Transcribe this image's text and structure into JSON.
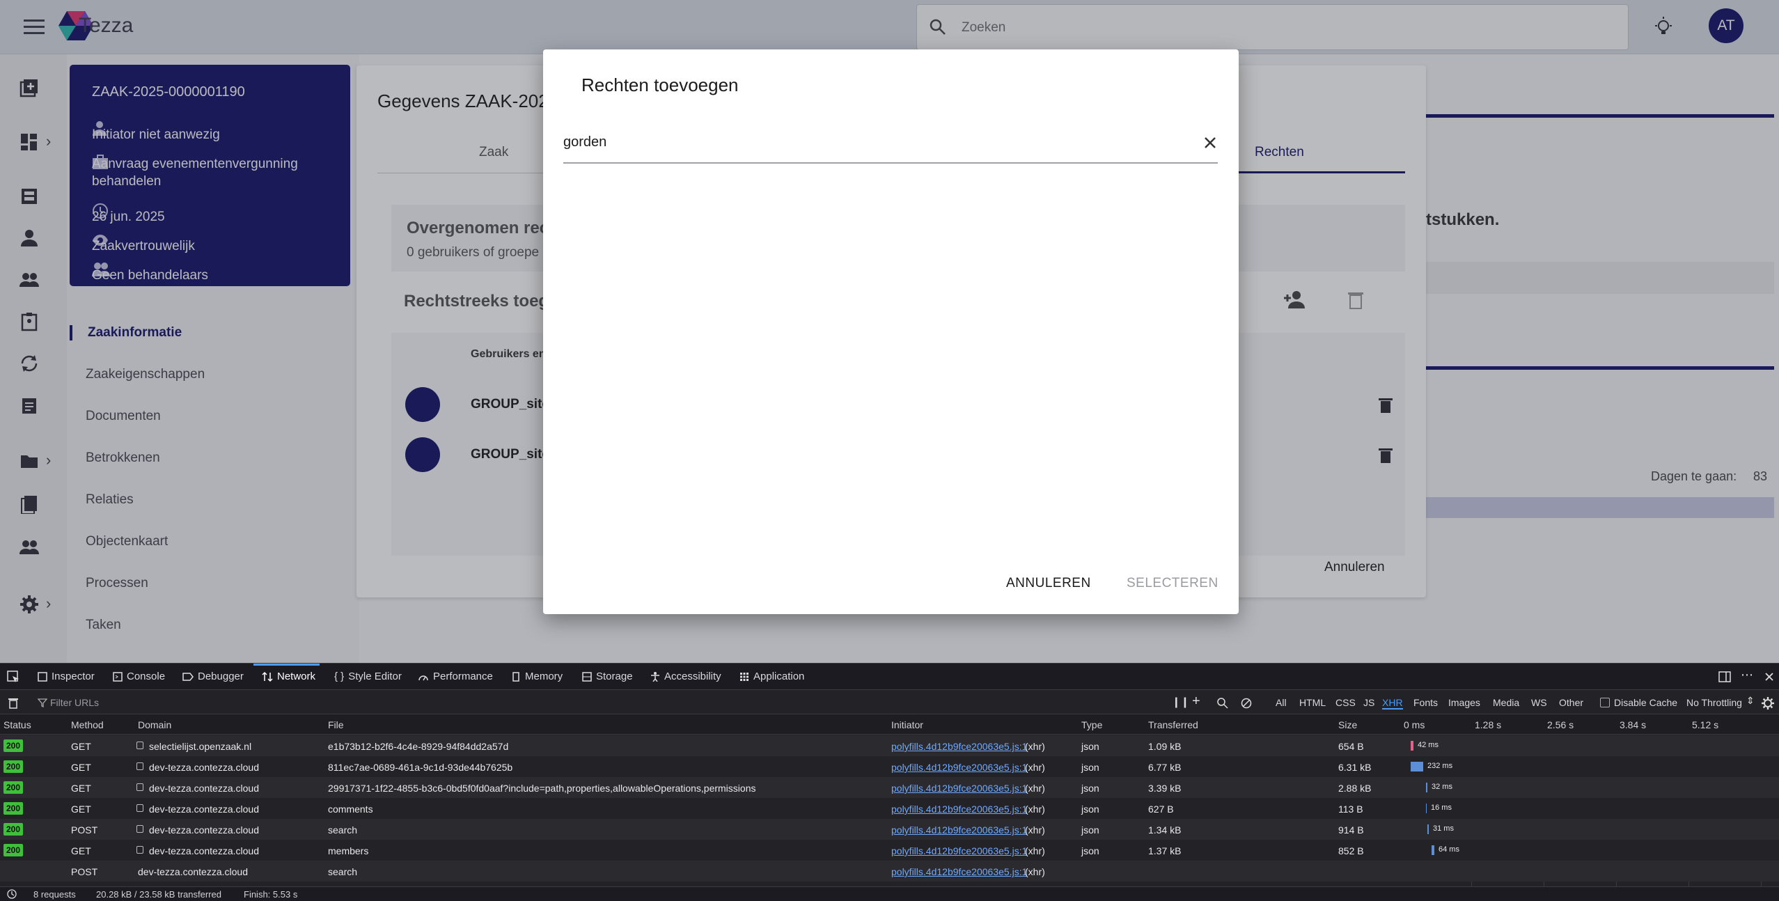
{
  "app": {
    "brand": "Tezza",
    "search_placeholder": "Zoeken",
    "avatar_initials": "AT"
  },
  "case_card": {
    "number": "ZAAK-2025-0000001190",
    "initiator": "Initiator niet aanwezig",
    "type": "Aanvraag evenementenvergunning behandelen",
    "date": "26 jun. 2025",
    "confidentiality": "Zaakvertrouwelijk",
    "handlers": "Geen behandelaars"
  },
  "nav": [
    "Zaakinformatie",
    "Zaakeigenschappen",
    "Documenten",
    "Betrokkenen",
    "Relaties",
    "Objectenkaart",
    "Processen",
    "Taken"
  ],
  "details_panel": {
    "title": "Gegevens ZAAK-2025",
    "tab_zaak": "Zaak",
    "tab_rechten": "Rechten",
    "inherited_title": "Overgenomen rech",
    "inherited_sub": "0 gebruikers of groepe",
    "direct_title": "Rechtstreeks toege",
    "col_users": "Gebruikers en",
    "groups": [
      "GROUP_site_",
      "GROUP_site_"
    ],
    "cancel": "Annuleren"
  },
  "right_panel": {
    "docs_text": "tstukken.",
    "days_label": "Dagen te gaan:",
    "days_value": "83"
  },
  "dialog": {
    "title": "Rechten toevoegen",
    "search_value": "gorden",
    "cancel": "ANNULEREN",
    "select": "SELECTEREN"
  },
  "devtools": {
    "tabs": [
      "Inspector",
      "Console",
      "Debugger",
      "Network",
      "Style Editor",
      "Performance",
      "Memory",
      "Storage",
      "Accessibility",
      "Application"
    ],
    "filter_placeholder": "Filter URLs",
    "type_filters": [
      "All",
      "HTML",
      "CSS",
      "JS",
      "XHR",
      "Fonts",
      "Images",
      "Media",
      "WS",
      "Other"
    ],
    "disable_cache": "Disable Cache",
    "throttling": "No Throttling",
    "columns": [
      "Status",
      "Method",
      "Domain",
      "File",
      "Initiator",
      "Type",
      "Transferred",
      "Size"
    ],
    "timeline_ticks": [
      "0 ms",
      "1.28 s",
      "2.56 s",
      "3.84 s",
      "5.12 s"
    ],
    "requests": [
      {
        "status": "200",
        "method": "GET",
        "domain": "selectielijst.openzaak.nl",
        "file": "e1b73b12-b2f6-4c4e-8929-94f84dd2a57d",
        "initiator": "polyfills.4d12b9fce20063e5.js:1",
        "itype": "(xhr)",
        "type": "json",
        "transferred": "1.09 kB",
        "size": "654 B",
        "timing": "42 ms"
      },
      {
        "status": "200",
        "method": "GET",
        "domain": "dev-tezza.contezza.cloud",
        "file": "811ec7ae-0689-461a-9c1d-93de44b7625b",
        "initiator": "polyfills.4d12b9fce20063e5.js:1",
        "itype": "(xhr)",
        "type": "json",
        "transferred": "6.77 kB",
        "size": "6.31 kB",
        "timing": "232 ms"
      },
      {
        "status": "200",
        "method": "GET",
        "domain": "dev-tezza.contezza.cloud",
        "file": "29917371-1f22-4855-b3c6-0bd5f0fd0aaf?include=path,properties,allowableOperations,permissions",
        "initiator": "polyfills.4d12b9fce20063e5.js:1",
        "itype": "(xhr)",
        "type": "json",
        "transferred": "3.39 kB",
        "size": "2.88 kB",
        "timing": "32 ms"
      },
      {
        "status": "200",
        "method": "GET",
        "domain": "dev-tezza.contezza.cloud",
        "file": "comments",
        "initiator": "polyfills.4d12b9fce20063e5.js:1",
        "itype": "(xhr)",
        "type": "json",
        "transferred": "627 B",
        "size": "113 B",
        "timing": "16 ms"
      },
      {
        "status": "200",
        "method": "POST",
        "domain": "dev-tezza.contezza.cloud",
        "file": "search",
        "initiator": "polyfills.4d12b9fce20063e5.js:1",
        "itype": "(xhr)",
        "type": "json",
        "transferred": "1.34 kB",
        "size": "914 B",
        "timing": "31 ms"
      },
      {
        "status": "200",
        "method": "GET",
        "domain": "dev-tezza.contezza.cloud",
        "file": "members",
        "initiator": "polyfills.4d12b9fce20063e5.js:1",
        "itype": "(xhr)",
        "type": "json",
        "transferred": "1.37 kB",
        "size": "852 B",
        "timing": "64 ms"
      },
      {
        "status": "",
        "method": "POST",
        "domain": "dev-tezza.contezza.cloud",
        "file": "search",
        "initiator": "polyfills.4d12b9fce20063e5.js:1",
        "itype": "(xhr)",
        "type": "",
        "transferred": "",
        "size": "",
        "timing": ""
      }
    ],
    "summary": {
      "requests": "8 requests",
      "transferred": "20.28 kB / 23.58 kB transferred",
      "finish": "Finish: 5.53 s"
    }
  }
}
